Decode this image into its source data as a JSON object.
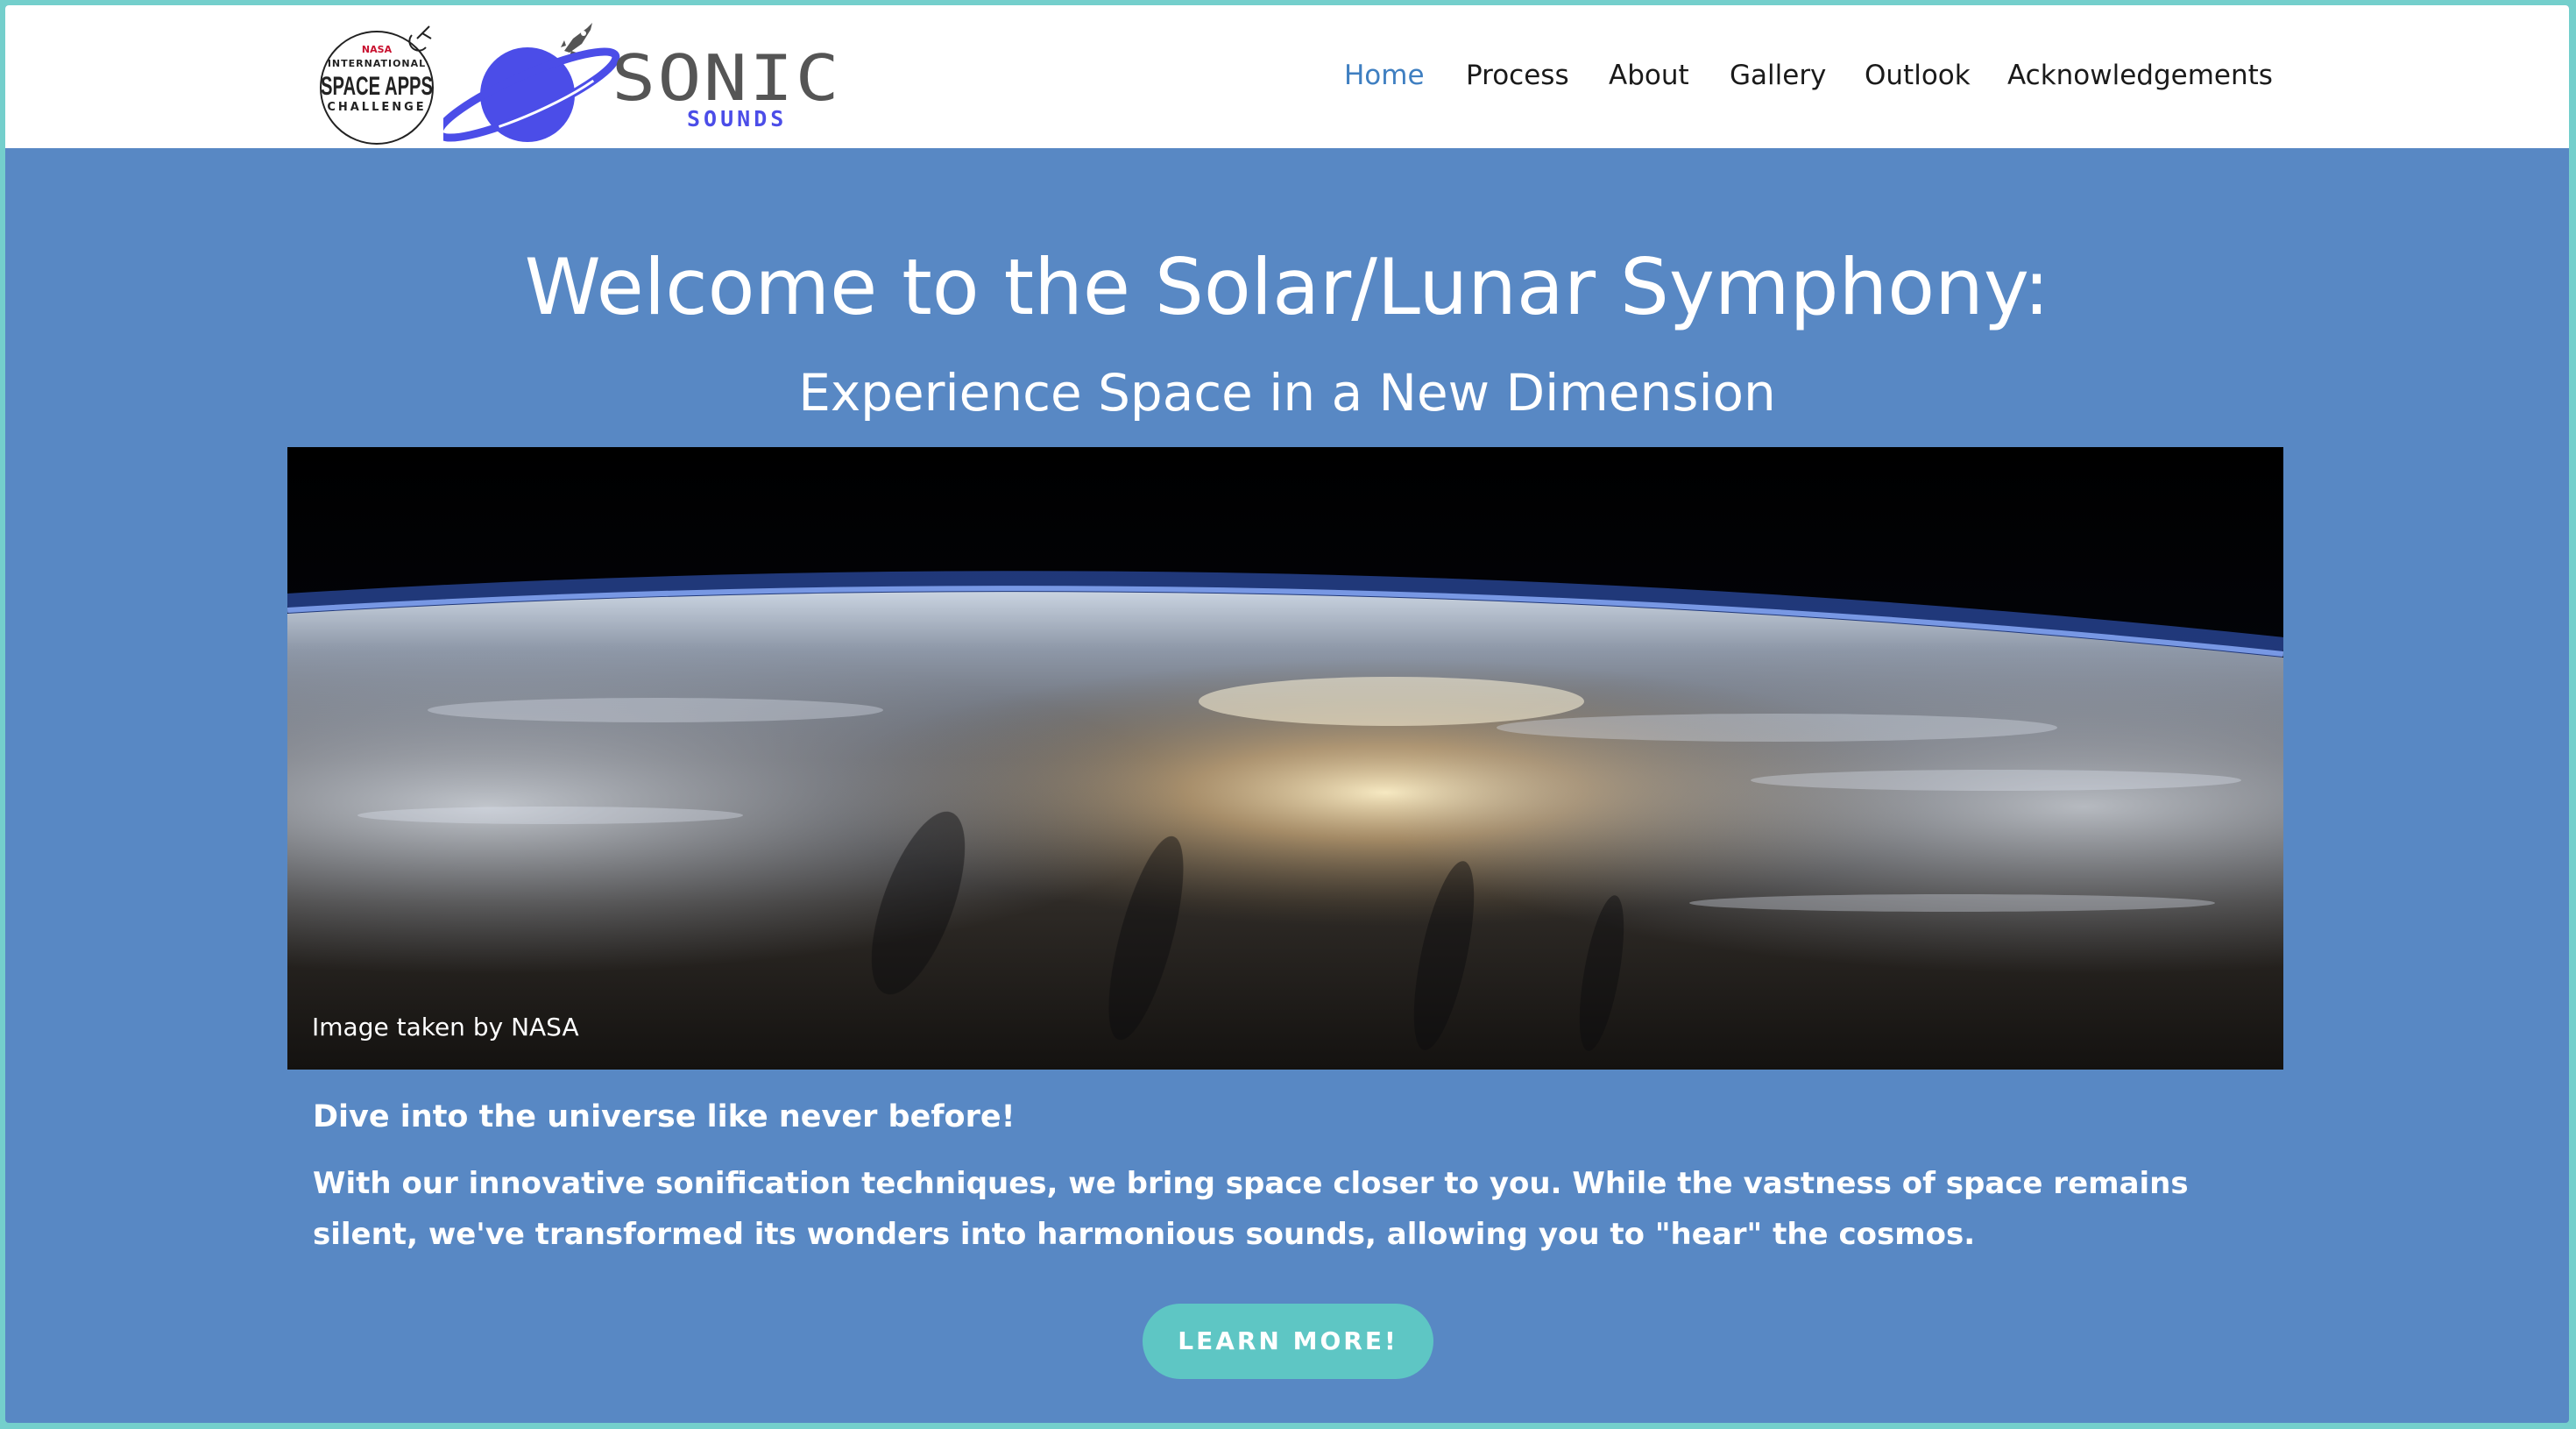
{
  "header": {
    "logos": {
      "challenge": {
        "agency": "NASA",
        "line1": "INTERNATIONAL",
        "line2": "SPACE APPS",
        "line3": "CHALLENGE"
      },
      "brand": {
        "name": "SONIC",
        "tagline": "SOUNDS"
      }
    },
    "nav": [
      {
        "label": "Home",
        "active": true
      },
      {
        "label": "Process",
        "active": false
      },
      {
        "label": "About",
        "active": false
      },
      {
        "label": "Gallery",
        "active": false
      },
      {
        "label": "Outlook",
        "active": false
      },
      {
        "label": "Acknowledgements",
        "active": false
      }
    ]
  },
  "hero": {
    "title": "Welcome to the Solar/Lunar Symphony:",
    "subtitle": "Experience Space in a New Dimension",
    "image_caption": "Image taken by NASA"
  },
  "intro": {
    "lead": "Dive into the universe like never before!",
    "body": "With our innovative sonification techniques, we bring space closer to you. While the vastness of space remains silent, we've transformed its wonders into harmonious sounds, allowing you to \"hear\" the cosmos.",
    "cta_label": "LEARN MORE!"
  },
  "colors": {
    "page_background": "#5888c4",
    "outer_border": "#74cfcc",
    "nav_active": "#3f7fc1",
    "cta_background": "#5ec6c4",
    "brand_purple": "#4b4de8"
  }
}
